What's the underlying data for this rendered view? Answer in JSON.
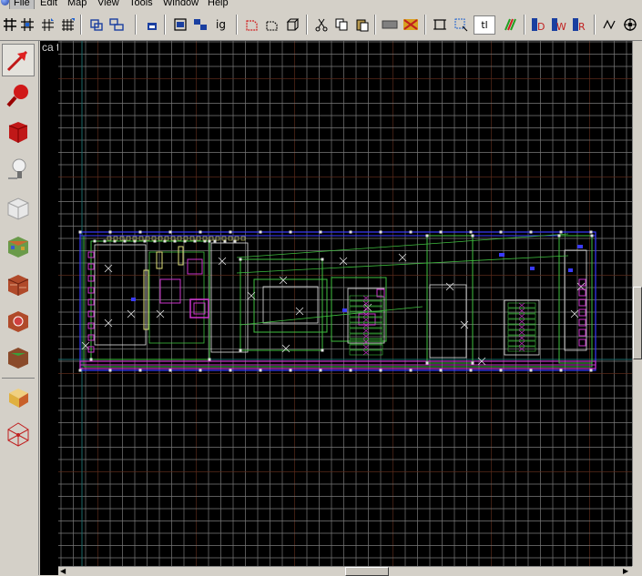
{
  "menu": {
    "items": [
      "File",
      "Edit",
      "Map",
      "View",
      "Tools",
      "Window",
      "Help"
    ]
  },
  "toolbar": {
    "icons": [
      "grid-toggle-icon",
      "grid-3d-icon",
      "grid-smaller-icon",
      "grid-larger-icon",
      "carve-icon",
      "group-icon",
      "ungroup-icon",
      "texture-lock-icon",
      "entity-icon",
      "ignore-groups-icon",
      "hide-icon",
      "show-icon",
      "selection-icon",
      "cut-icon",
      "copy-icon",
      "paste-icon",
      "texture-bar-icon",
      "texture-app-icon",
      "toggle-bounds-icon",
      "select-region-icon",
      "text-icon",
      "compile-icon",
      "doc-icon",
      "run-icon",
      "go-icon",
      "anim-icon",
      "settings-icon"
    ],
    "ignore_label": "ig",
    "text_label": "tl"
  },
  "tools": [
    "selection-tool-icon",
    "magnify-tool-icon",
    "camera-tool-icon",
    "entity-tool-icon",
    "block-tool-icon",
    "texture-app-tool-icon",
    "apply-decal-tool-icon",
    "overlay-tool-icon",
    "clipping-tool-icon",
    "vertex-tool-icon",
    "path-tool-icon"
  ],
  "viewport": {
    "label": "camera top (x/y)",
    "visible_label": "ca top (x/y)",
    "grid_color": "#7a7a7a",
    "axis_color": "#5a2a1a"
  },
  "colors": {
    "background": "#d4d0c8",
    "viewport_bg": "#000000",
    "brush_blue": "#3a3aff",
    "brush_green": "#3fbf3f",
    "brush_magenta": "#cc33cc",
    "brush_white": "#e0e0e0",
    "brush_yellow": "#e0e07a"
  }
}
